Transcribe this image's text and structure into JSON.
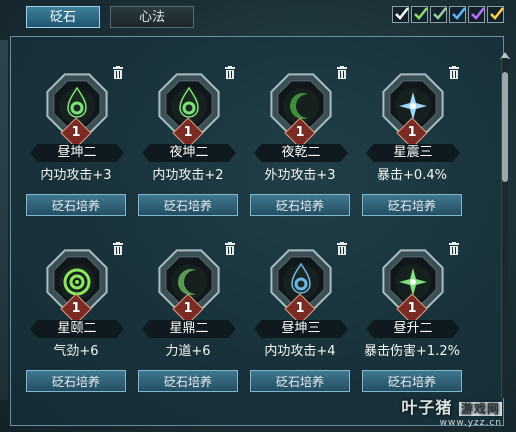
{
  "tabs": [
    {
      "label": "砭石",
      "active": true
    },
    {
      "label": "心法",
      "active": false
    }
  ],
  "check_colors": [
    "#ffffff",
    "#8fdc6a",
    "#9acf9a",
    "#5db7ff",
    "#c06cff",
    "#ffd24a"
  ],
  "cards": [
    {
      "name": "昼坤二",
      "stat": "内功攻击+3",
      "level": "1",
      "button": "砭石培养",
      "glyph": "drop-ring",
      "glow": "#7fe27a"
    },
    {
      "name": "夜坤二",
      "stat": "内功攻击+2",
      "level": "1",
      "button": "砭石培养",
      "glyph": "drop-ring",
      "glow": "#7fe27a"
    },
    {
      "name": "夜乾二",
      "stat": "外功攻击+3",
      "level": "1",
      "button": "砭石培养",
      "glyph": "crescent",
      "glow": "#3f8f3a"
    },
    {
      "name": "星震三",
      "stat": "暴击+0.4%",
      "level": "1",
      "button": "砭石培养",
      "glyph": "star",
      "glow": "#9fd8ff"
    },
    {
      "name": "星颐二",
      "stat": "气劲+6",
      "level": "1",
      "button": "砭石培养",
      "glyph": "swirl",
      "glow": "#8ee85e"
    },
    {
      "name": "星鼎二",
      "stat": "力道+6",
      "level": "1",
      "button": "砭石培养",
      "glyph": "crescent",
      "glow": "#5a9a52"
    },
    {
      "name": "昼坤三",
      "stat": "内功攻击+4",
      "level": "1",
      "button": "砭石培养",
      "glyph": "drop-ring",
      "glow": "#6fb6e8"
    },
    {
      "name": "昼升二",
      "stat": "暴击伤害+1.2%",
      "level": "1",
      "button": "砭石培养",
      "glyph": "star",
      "glow": "#7fe27a"
    }
  ],
  "watermark": {
    "logo_a": "叶子猪",
    "logo_b": "游戏网",
    "url": "www.yzz.cn"
  }
}
